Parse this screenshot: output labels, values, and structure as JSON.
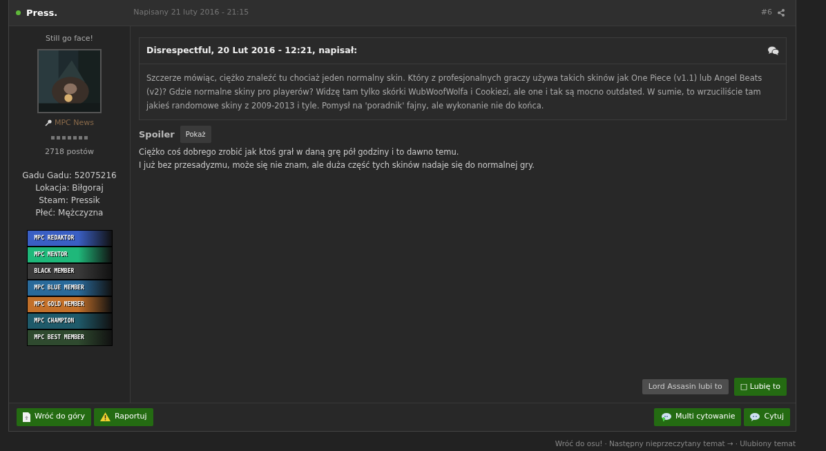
{
  "post": {
    "author": "Press.",
    "online": true,
    "date": "Napisany 21 luty 2016 - 21:15",
    "number": "#6"
  },
  "profile": {
    "title": "Still go face!",
    "group": "MPC News",
    "posts": "2718 postów",
    "fields": [
      "Gadu Gadu: 52075216",
      "Lokacja: Biłgoraj",
      "Steam: Pressik",
      "Płeć: Mężczyzna"
    ],
    "badges": [
      {
        "label": "MPC REDAKTOR",
        "color": "#3a5fc4"
      },
      {
        "label": "MPC MENTOR",
        "color": "#1fb87a"
      },
      {
        "label": "BLACK MEMBER",
        "color": "#3a3a3a"
      },
      {
        "label": "MPC BLUE MEMBER",
        "color": "#2a6a9a"
      },
      {
        "label": "MPC GOLD MEMBER",
        "color": "#c2702a"
      },
      {
        "label": "MPC CHAMPION",
        "color": "#1f5a6a"
      },
      {
        "label": "MPC BEST MEMBER",
        "color": "#2f4a2f"
      }
    ]
  },
  "quote": {
    "citation": "Disrespectful, 20 Lut 2016 - 12:21, napisał:",
    "text": "Szczerze mówiąc, ciężko znaleźć tu chociaż jeden normalny skin. Który z profesjonalnych graczy używa takich skinów jak One Piece (v1.1) lub Angel Beats (v2)? Gdzie normalne skiny pro playerów? Widzę tam tylko skórki WubWoofWolfa i Cookiezi, ale one i tak są mocno outdated. W sumie, to wrzuciliście tam jakieś randomowe skiny z 2009-2013 i tyle. Pomysł na 'poradnik' fajny, ale wykonanie nie do końca."
  },
  "spoiler": {
    "label": "Spoiler",
    "button": "Pokaż"
  },
  "body": [
    "Ciężko coś dobrego zrobić jak ktoś grał w daną grę pół godziny i to dawno temu.",
    "I już bez przesadyzmu, może się nie znam, ale duża część tych skinów nadaje się do normalnej gry."
  ],
  "likes": {
    "text": "Lord Assasin lubi to",
    "button": "□ Lubię to"
  },
  "actions_left": [
    {
      "label": "Wróć do góry",
      "kind": "top"
    },
    {
      "label": "Raportuj",
      "kind": "report"
    }
  ],
  "actions_right": [
    {
      "label": "Multi cytowanie",
      "kind": "multiquote"
    },
    {
      "label": "Cytuj",
      "kind": "quote"
    }
  ],
  "bottom_links": [
    "Wróć do osu!",
    "·",
    "Następny nieprzeczytany temat →",
    "·",
    "Ulubiony temat"
  ]
}
